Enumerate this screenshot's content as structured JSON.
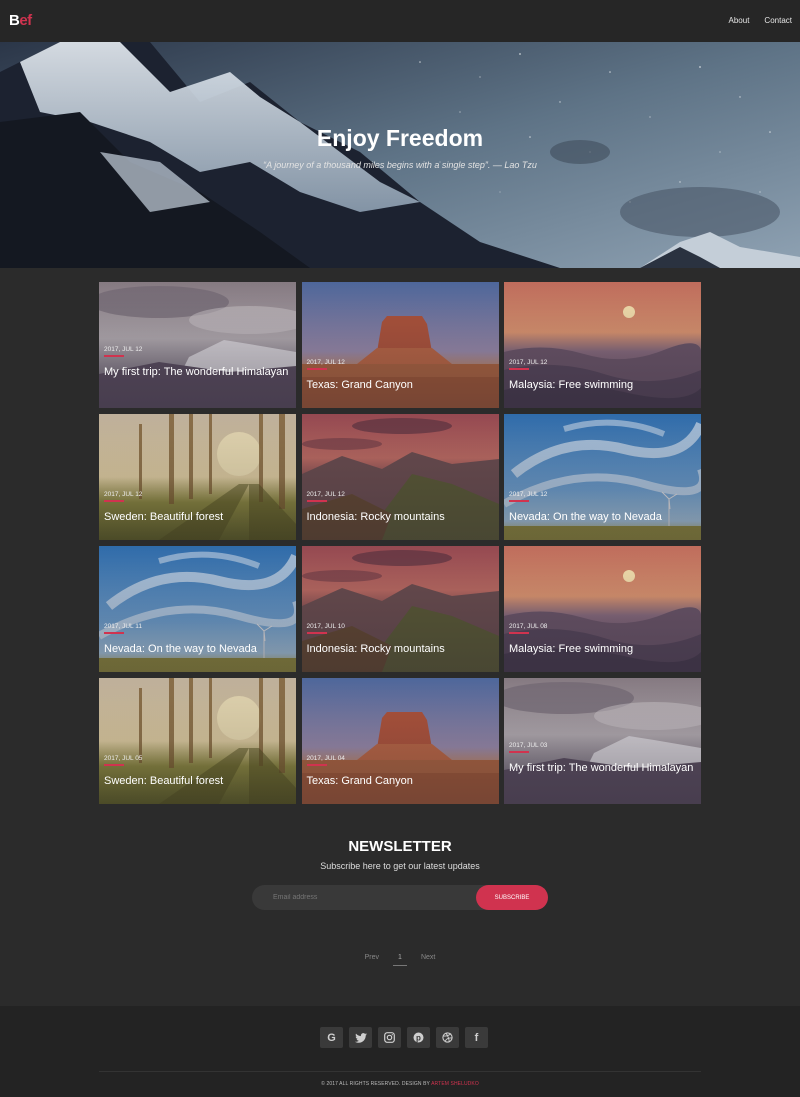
{
  "header": {
    "logo_first": "B",
    "logo_rest": "ef",
    "nav": [
      "About",
      "Contact"
    ]
  },
  "hero": {
    "title": "Enjoy Freedom",
    "quote": "“A journey of a thousand miles begins with a single step”. — Lao Tzu"
  },
  "posts": [
    {
      "date": "2017, JUL 12",
      "title": "My first trip: The wonderful Himalayan",
      "scene": "himalaya"
    },
    {
      "date": "2017, JUL 12",
      "title": "Texas: Grand Canyon",
      "scene": "canyon"
    },
    {
      "date": "2017, JUL 12",
      "title": "Malaysia: Free swimming",
      "scene": "sea"
    },
    {
      "date": "2017, JUL 12",
      "title": "Sweden: Beautiful forest",
      "scene": "forest"
    },
    {
      "date": "2017, JUL 12",
      "title": "Indonesia: Rocky mountains",
      "scene": "rocky"
    },
    {
      "date": "2017, JUL 12",
      "title": "Nevada: On the way to Nevada",
      "scene": "sky"
    },
    {
      "date": "2017, JUL 11",
      "title": "Nevada: On the way to Nevada",
      "scene": "sky"
    },
    {
      "date": "2017, JUL 10",
      "title": "Indonesia: Rocky mountains",
      "scene": "rocky"
    },
    {
      "date": "2017, JUL 08",
      "title": "Malaysia: Free swimming",
      "scene": "sea"
    },
    {
      "date": "2017, JUL 05",
      "title": "Sweden: Beautiful forest",
      "scene": "forest"
    },
    {
      "date": "2017, JUL 04",
      "title": "Texas: Grand Canyon",
      "scene": "canyon"
    },
    {
      "date": "2017, JUL 03",
      "title": "My first trip: The wonderful Himalayan",
      "scene": "himalaya"
    }
  ],
  "newsletter": {
    "title": "NEWSLETTER",
    "subtitle": "Subscribe here to get our latest updates",
    "placeholder": "Email address",
    "button": "SUBSCRIBE"
  },
  "pager": {
    "prev": "Prev",
    "current": "1",
    "next": "Next"
  },
  "footer": {
    "socials": [
      "google-icon",
      "twitter-icon",
      "instagram-icon",
      "pinterest-icon",
      "dribbble-icon",
      "facebook-icon"
    ],
    "copyright": "© 2017 ALL RIGHTS RESERVED. DESIGN BY ",
    "designer": "ARTEM SHELUDKO"
  },
  "colors": {
    "accent": "#d0334f",
    "page_bg": "#2b2b2b",
    "header_bg": "#262626",
    "footer_bg": "#232323"
  }
}
